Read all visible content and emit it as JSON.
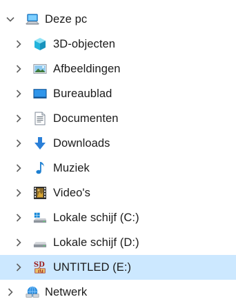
{
  "tree": {
    "this_pc": {
      "label": "Deze pc",
      "icon": "computer-icon",
      "expanded": true
    },
    "children": [
      {
        "label": "3D-objecten",
        "icon": "3d-objects-icon"
      },
      {
        "label": "Afbeeldingen",
        "icon": "pictures-icon"
      },
      {
        "label": "Bureaublad",
        "icon": "desktop-icon"
      },
      {
        "label": "Documenten",
        "icon": "documents-icon"
      },
      {
        "label": "Downloads",
        "icon": "downloads-icon"
      },
      {
        "label": "Muziek",
        "icon": "music-icon"
      },
      {
        "label": "Video's",
        "icon": "videos-icon"
      },
      {
        "label": "Lokale schijf (C:)",
        "icon": "system-drive-icon"
      },
      {
        "label": "Lokale schijf (D:)",
        "icon": "drive-icon"
      },
      {
        "label": "UNTITLED (E:)",
        "icon": "sd-card-icon",
        "selected": true,
        "icon_text": "SD"
      }
    ],
    "network": {
      "label": "Netwerk",
      "icon": "network-icon",
      "expanded": false
    }
  },
  "colors": {
    "selection": "#cce8ff",
    "chevron": "#5f5f5f",
    "text": "#1a1a1a"
  }
}
